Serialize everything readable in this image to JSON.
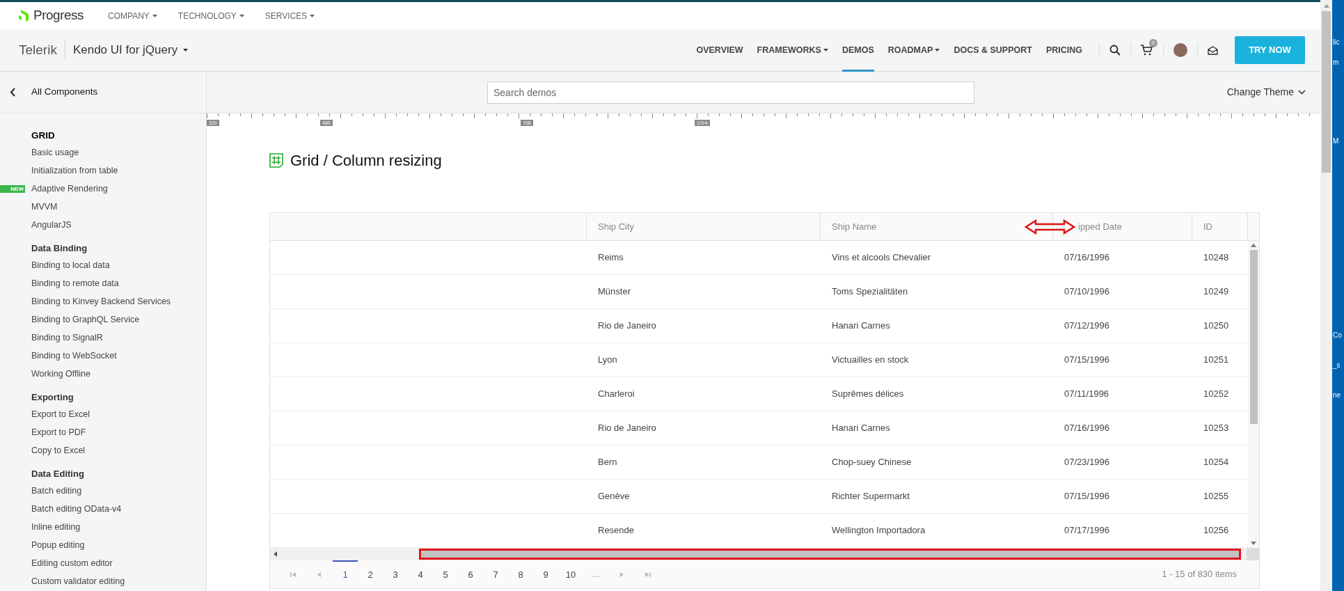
{
  "top_bar": {
    "brand": "Progress",
    "menu": [
      {
        "label": "COMPANY"
      },
      {
        "label": "TECHNOLOGY"
      },
      {
        "label": "SERVICES"
      }
    ]
  },
  "product_bar": {
    "brand": "Telerik",
    "product": "Kendo UI for jQuery",
    "nav": [
      {
        "label": "OVERVIEW",
        "dropdown": false,
        "selected": false
      },
      {
        "label": "FRAMEWORKS",
        "dropdown": true,
        "selected": false
      },
      {
        "label": "DEMOS",
        "dropdown": false,
        "selected": true
      },
      {
        "label": "ROADMAP",
        "dropdown": true,
        "selected": false
      },
      {
        "label": "DOCS & SUPPORT",
        "dropdown": false,
        "selected": false
      },
      {
        "label": "PRICING",
        "dropdown": false,
        "selected": false
      }
    ],
    "cart_count": "0",
    "cta": "TRY NOW"
  },
  "sidebar": {
    "back": "All Components",
    "sections": [
      {
        "title": "GRID",
        "items": [
          {
            "label": "Basic usage"
          },
          {
            "label": "Initialization from table"
          },
          {
            "label": "Adaptive Rendering",
            "badge": "NEW"
          },
          {
            "label": "MVVM"
          },
          {
            "label": "AngularJS"
          }
        ]
      },
      {
        "title": "Data Binding",
        "items": [
          {
            "label": "Binding to local data"
          },
          {
            "label": "Binding to remote data"
          },
          {
            "label": "Binding to Kinvey Backend Services"
          },
          {
            "label": "Binding to GraphQL Service"
          },
          {
            "label": "Binding to SignalR"
          },
          {
            "label": "Binding to WebSocket"
          },
          {
            "label": "Working Offline"
          }
        ]
      },
      {
        "title": "Exporting",
        "items": [
          {
            "label": "Export to Excel"
          },
          {
            "label": "Export to PDF"
          },
          {
            "label": "Copy to Excel"
          }
        ]
      },
      {
        "title": "Data Editing",
        "items": [
          {
            "label": "Batch editing"
          },
          {
            "label": "Batch editing OData-v4"
          },
          {
            "label": "Inline editing"
          },
          {
            "label": "Popup editing"
          },
          {
            "label": "Editing custom editor"
          },
          {
            "label": "Custom validator editing"
          }
        ]
      }
    ]
  },
  "search": {
    "placeholder": "Search demos"
  },
  "change_theme": "Change Theme",
  "ruler": {
    "labels": [
      "320",
      "480",
      "768",
      "1024"
    ]
  },
  "title": "Grid / Column resizing",
  "grid": {
    "columns": [
      {
        "label": "Ship City"
      },
      {
        "label": "Ship Name"
      },
      {
        "label": "ipped Date"
      },
      {
        "label": "ID"
      }
    ],
    "rows": [
      [
        "Reims",
        "Vins et alcools Chevalier",
        "07/16/1996",
        "10248"
      ],
      [
        "Münster",
        "Toms Spezialitäten",
        "07/10/1996",
        "10249"
      ],
      [
        "Rio de Janeiro",
        "Hanari Carnes",
        "07/12/1996",
        "10250"
      ],
      [
        "Lyon",
        "Victuailles en stock",
        "07/15/1996",
        "10251"
      ],
      [
        "Charleroi",
        "Suprêmes délices",
        "07/11/1996",
        "10252"
      ],
      [
        "Rio de Janeiro",
        "Hanari Carnes",
        "07/16/1996",
        "10253"
      ],
      [
        "Bern",
        "Chop-suey Chinese",
        "07/23/1996",
        "10254"
      ],
      [
        "Genève",
        "Richter Supermarkt",
        "07/15/1996",
        "10255"
      ],
      [
        "Resende",
        "Wellington Importadora",
        "07/17/1996",
        "10256"
      ]
    ]
  },
  "pager": {
    "pages": [
      {
        "label": "1",
        "selected": true
      },
      {
        "label": "2",
        "selected": false
      },
      {
        "label": "3",
        "selected": false
      },
      {
        "label": "4",
        "selected": false
      },
      {
        "label": "5",
        "selected": false
      },
      {
        "label": "6",
        "selected": false
      },
      {
        "label": "7",
        "selected": false
      },
      {
        "label": "8",
        "selected": false
      },
      {
        "label": "9",
        "selected": false
      },
      {
        "label": "10",
        "selected": false
      }
    ],
    "ellipsis": "...",
    "info": "1 - 15 of 830 items"
  },
  "background_window": {
    "fragments": [
      "lic",
      "m",
      "M",
      "Co",
      "_s",
      "ne"
    ]
  }
}
